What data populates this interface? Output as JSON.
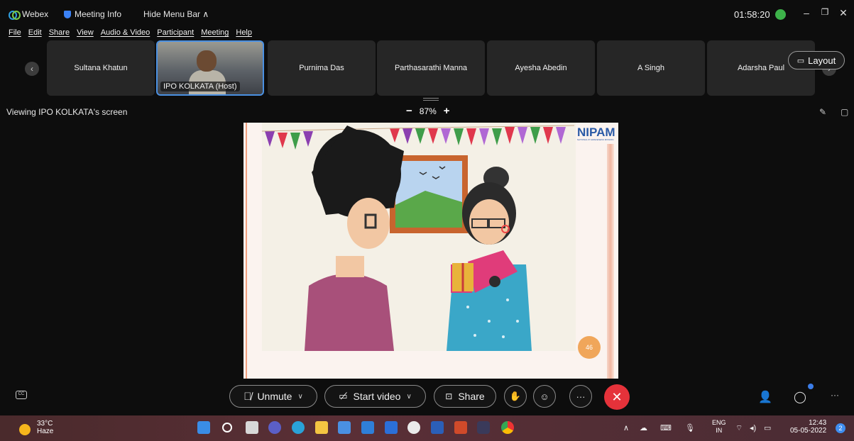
{
  "titlebar": {
    "app_name": "Webex",
    "meeting_info": "Meeting Info",
    "hide_menu": "Hide Menu Bar ∧",
    "clock": "01:58:20"
  },
  "menu": [
    "File",
    "Edit",
    "Share",
    "View",
    "Audio & Video",
    "Participant",
    "Meeting",
    "Help"
  ],
  "participants": [
    {
      "name": "Sultana Khatun"
    },
    {
      "name": "IPO KOLKATA (Host)"
    },
    {
      "name": "Purnima Das"
    },
    {
      "name": "Parthasarathi Manna"
    },
    {
      "name": "Ayesha Abedin"
    },
    {
      "name": "A Singh"
    },
    {
      "name": "Adarsha Paul"
    }
  ],
  "layout_label": "Layout",
  "viewing_label": "Viewing IPO KOLKATA's screen",
  "zoom": {
    "minus": "−",
    "level": "87%",
    "plus": "+"
  },
  "shared": {
    "logo": "NIPAM",
    "logo_sub": "NATIONAL IP AWARENESS MISSION",
    "page_number": "46"
  },
  "controls": {
    "unmute": "Unmute",
    "start_video": "Start video",
    "share": "Share"
  },
  "taskbar": {
    "temp": "33°C",
    "weather": "Haze",
    "lang_1": "ENG",
    "lang_2": "IN",
    "time": "12:43",
    "date": "05-05-2022",
    "notifications": "2"
  },
  "colors": {
    "end_call": "#e5323a",
    "host_border": "#4a90e2",
    "accent": "#3b7de8"
  }
}
